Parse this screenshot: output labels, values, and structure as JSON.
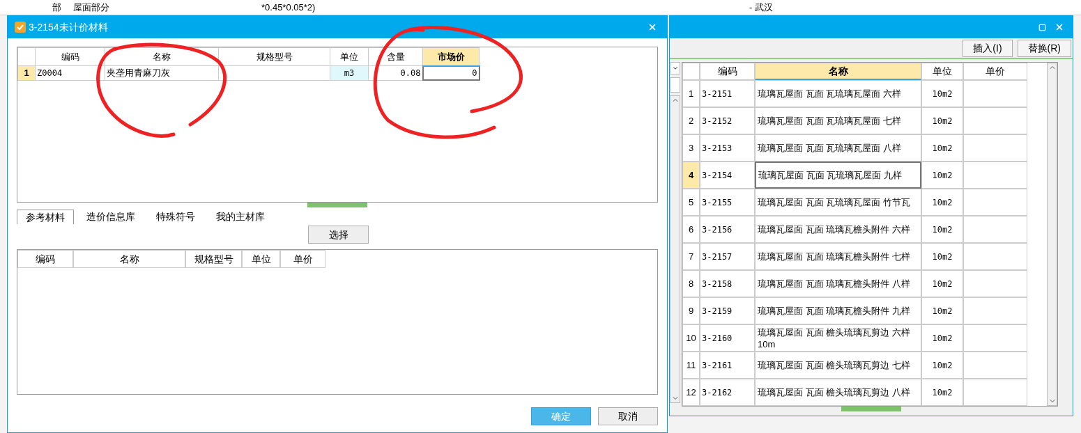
{
  "background_sheet": {
    "cells": [
      "部",
      "屋面部分",
      "*0.45*0.05*2)",
      "- 武汉"
    ]
  },
  "dialog": {
    "title": "3-2154未计价材料",
    "material_table": {
      "columns": [
        {
          "label": "编码",
          "selected": false
        },
        {
          "label": "名称",
          "selected": false
        },
        {
          "label": "规格型号",
          "selected": false
        },
        {
          "label": "单位",
          "selected": false
        },
        {
          "label": "含量",
          "selected": false
        },
        {
          "label": "市场价",
          "selected": true
        }
      ],
      "rows": [
        {
          "index": "1",
          "code": "Z0004",
          "name": "夹垄用青麻刀灰",
          "unit": "m3",
          "amount": "0.08",
          "market_price": "0",
          "selected": true
        }
      ]
    },
    "tabs": [
      {
        "label": "参考材料",
        "selected": true
      },
      {
        "label": "造价信息库",
        "selected": false
      },
      {
        "label": "特殊符号",
        "selected": false
      },
      {
        "label": "我的主材库",
        "selected": false
      }
    ],
    "select_button": "选择",
    "reference_table": {
      "columns": [
        "编码",
        "名称",
        "规格型号",
        "单位",
        "单价"
      ]
    },
    "buttons": [
      {
        "label": "确定",
        "kind": "primary"
      },
      {
        "label": "取消",
        "kind": "default"
      }
    ]
  },
  "quota_window": {
    "toolbar": [
      "插入(I)",
      "替换(R)"
    ],
    "columns": [
      {
        "label": "编码",
        "selected": false
      },
      {
        "label": "名称",
        "selected": true
      },
      {
        "label": "单位",
        "selected": false
      },
      {
        "label": "单价",
        "selected": false
      }
    ],
    "rows": [
      {
        "index": "1",
        "code": "3-2151",
        "name": "琉璃瓦屋面 瓦面 瓦琉璃瓦屋面 六样",
        "unit": "10m2",
        "selected": false
      },
      {
        "index": "2",
        "code": "3-2152",
        "name": "琉璃瓦屋面 瓦面 瓦琉璃瓦屋面 七样",
        "unit": "10m2",
        "selected": false
      },
      {
        "index": "3",
        "code": "3-2153",
        "name": "琉璃瓦屋面 瓦面 瓦琉璃瓦屋面 八样",
        "unit": "10m2",
        "selected": false
      },
      {
        "index": "4",
        "code": "3-2154",
        "name": "琉璃瓦屋面 瓦面 瓦琉璃瓦屋面 九样",
        "unit": "10m2",
        "selected": true
      },
      {
        "index": "5",
        "code": "3-2155",
        "name": "琉璃瓦屋面 瓦面 瓦琉璃瓦屋面 竹节瓦",
        "unit": "10m2",
        "selected": false
      },
      {
        "index": "6",
        "code": "3-2156",
        "name": "琉璃瓦屋面 瓦面 琉璃瓦檐头附件 六样",
        "unit": "10m2",
        "selected": false
      },
      {
        "index": "7",
        "code": "3-2157",
        "name": "琉璃瓦屋面 瓦面 琉璃瓦檐头附件 七样",
        "unit": "10m2",
        "selected": false
      },
      {
        "index": "8",
        "code": "3-2158",
        "name": "琉璃瓦屋面 瓦面 琉璃瓦檐头附件 八样",
        "unit": "10m2",
        "selected": false
      },
      {
        "index": "9",
        "code": "3-2159",
        "name": "琉璃瓦屋面 瓦面 琉璃瓦檐头附件 九样",
        "unit": "10m2",
        "selected": false
      },
      {
        "index": "10",
        "code": "3-2160",
        "name": "琉璃瓦屋面 瓦面 檐头琉璃瓦剪边 六样 10m",
        "unit": "10m2",
        "selected": false
      },
      {
        "index": "11",
        "code": "3-2161",
        "name": "琉璃瓦屋面 瓦面 檐头琉璃瓦剪边 七样",
        "unit": "10m2",
        "selected": false
      },
      {
        "index": "12",
        "code": "3-2162",
        "name": "琉璃瓦屋面 瓦面 檐头琉璃瓦剪边 八样",
        "unit": "10m2",
        "selected": false
      }
    ]
  }
}
